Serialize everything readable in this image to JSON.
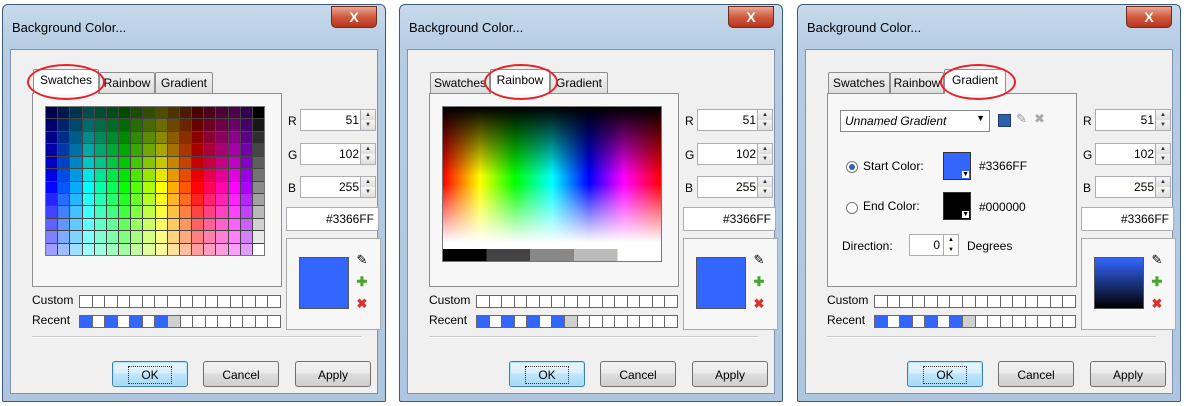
{
  "dialogs": [
    {
      "title": "Background Color...",
      "close_label": "X",
      "tabs": [
        "Swatches",
        "Rainbow",
        "Gradient"
      ],
      "active_tab": "Swatches",
      "r_label": "R",
      "g_label": "G",
      "b_label": "B",
      "r": "51",
      "g": "102",
      "b": "255",
      "hex": "#3366FF",
      "custom_label": "Custom",
      "recent_label": "Recent",
      "ok": "OK",
      "cancel": "Cancel",
      "apply": "Apply"
    },
    {
      "title": "Background Color...",
      "close_label": "X",
      "tabs": [
        "Swatches",
        "Rainbow",
        "Gradient"
      ],
      "active_tab": "Rainbow",
      "r_label": "R",
      "g_label": "G",
      "b_label": "B",
      "r": "51",
      "g": "102",
      "b": "255",
      "hex": "#3366FF",
      "custom_label": "Custom",
      "recent_label": "Recent",
      "ok": "OK",
      "cancel": "Cancel",
      "apply": "Apply"
    },
    {
      "title": "Background Color...",
      "close_label": "X",
      "tabs": [
        "Swatches",
        "Rainbow",
        "Gradient"
      ],
      "active_tab": "Gradient",
      "r_label": "R",
      "g_label": "G",
      "b_label": "B",
      "r": "51",
      "g": "102",
      "b": "255",
      "hex": "#3366FF",
      "custom_label": "Custom",
      "recent_label": "Recent",
      "ok": "OK",
      "cancel": "Cancel",
      "apply": "Apply",
      "gradient": {
        "preset": "Unnamed Gradient",
        "start_label": "Start Color:",
        "start_color": "#3366FF",
        "end_label": "End Color:",
        "end_color": "#000000",
        "direction_label": "Direction:",
        "direction_value": "0",
        "direction_unit": "Degrees",
        "start_selected": true
      }
    }
  ],
  "colors": {
    "current": "#3366FF",
    "highlight": "#E8202A",
    "recent": [
      "#3366FF",
      "#FFFFFF",
      "#3366FF",
      "#FFFFFF",
      "#3366FF",
      "#FFFFFF",
      "#3366FF",
      "#D0D0D0"
    ]
  },
  "icons": [
    "eyedropper-icon",
    "plus-icon",
    "delete-icon",
    "save-icon",
    "pencil-icon",
    "remove-icon"
  ]
}
